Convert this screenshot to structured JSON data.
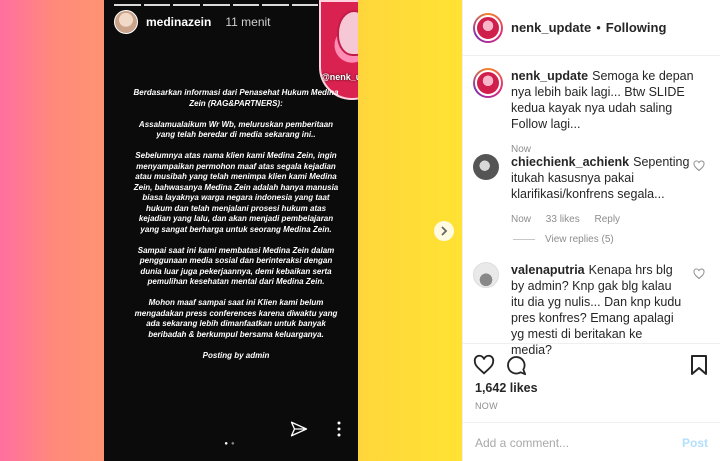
{
  "story": {
    "username": "medinazein",
    "time": "11 menit",
    "sticker_label": "@nenk_update",
    "paragraphs": [
      "Berdasarkan informasi dari Penasehat Hukum Medina Zein (RAG&PARTNERS):",
      "Assalamualaikum Wr Wb, meluruskan pemberitaan yang telah beredar di media sekarang ini..",
      "Sebelumnya atas nama klien kami Medina Zein, ingin menyampaikan permohon maaf atas segala kejadian atau musibah yang telah menimpa klien kami Medina Zein, bahwasanya Medina Zein adalah hanya manusia biasa layaknya warga negara indonesia yang taat hukum dan telah menjalani prosesi hukum atas kejadian yang lalu, dan akan menjadi pembelajaran yang sangat berharga untuk seorang Medina Zein.",
      "Sampai saat ini kami membatasi Medina Zein dalam penggunaan media sosial dan berinteraksi dengan dunia luar juga pekerjaannya, demi kebaikan serta pemulihan kesehatan mental dari Medina Zein.",
      "Mohon maaf sampai saat ini Klien kami belum mengadakan press conferences karena diwaktu yang ada sekarang lebih dimanfaatkan untuk banyak beribadah & berkumpul bersama keluarganya.",
      "Posting by admin"
    ]
  },
  "header": {
    "username": "nenk_update",
    "separator": "•",
    "follow_status": "Following"
  },
  "caption": {
    "username": "nenk_update",
    "text": "Semoga ke depan nya lebih baik lagi... Btw SLIDE kedua kayak nya udah saling Follow lagi...",
    "time": "Now"
  },
  "comments": [
    {
      "username": "chiechienk_achienk",
      "text": "Sepenting itukah kasusnya pakai klarifikasi/konfrens segala...",
      "time": "Now",
      "likes": "33 likes",
      "reply": "Reply"
    },
    {
      "username": "valenaputria",
      "text": "Kenapa hrs blg by admin? Knp gak blg kalau itu dia yg nulis... Dan knp kudu pres konfres? Emang apalagi yg mesti di beritakan ke media?",
      "time": "",
      "likes": "",
      "reply": ""
    }
  ],
  "view_replies": "View replies (5)",
  "likes_count": "1,642 likes",
  "timestamp": "NOW",
  "add_comment": {
    "placeholder": "Add a comment...",
    "post_label": "Post"
  }
}
